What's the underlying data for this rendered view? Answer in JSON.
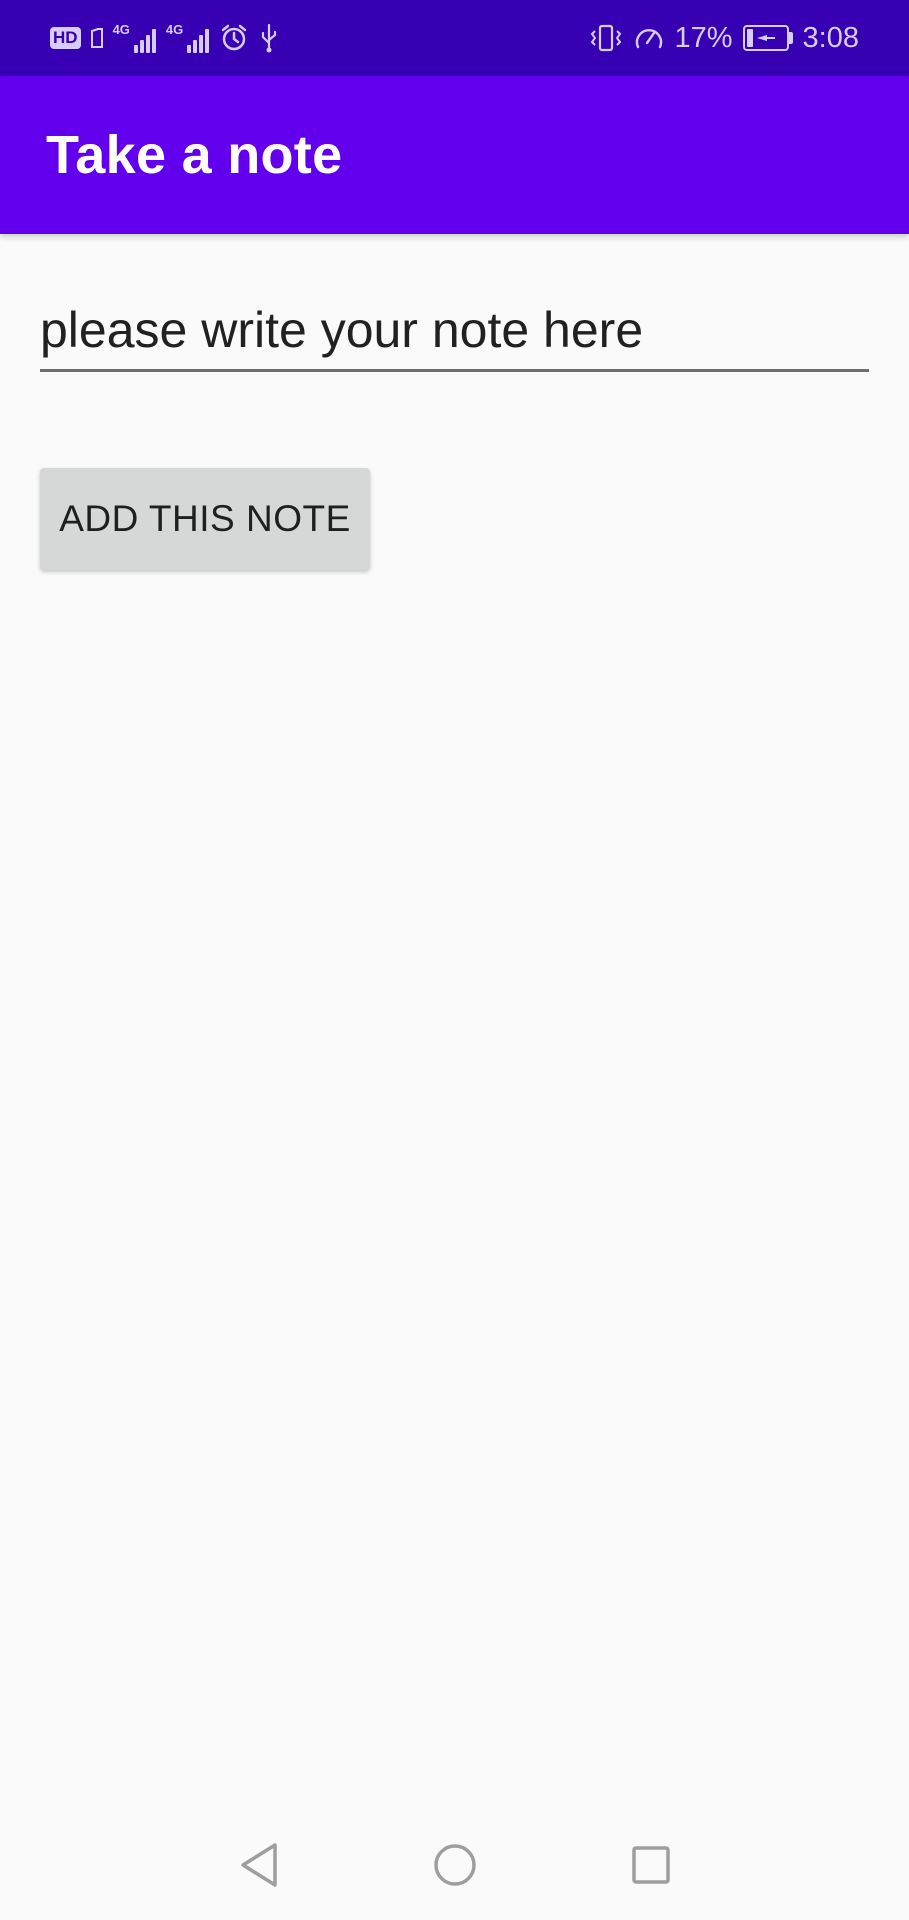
{
  "status_bar": {
    "hd_label": "HD",
    "signal_1_network": "4G",
    "signal_2_network": "4G",
    "speed_percent": "17%",
    "time": "3:08",
    "battery_level": 0.17,
    "icons": [
      "hd-icon",
      "sim-icon",
      "signal-icon",
      "signal-icon",
      "alarm-icon",
      "usb-icon",
      "vibrate-icon",
      "speedometer-icon",
      "battery-charging-icon"
    ]
  },
  "app_bar": {
    "title": "Take a note",
    "color": "#6200ee"
  },
  "note_field": {
    "placeholder": "please write your note here",
    "value": ""
  },
  "add_button": {
    "label": "ADD THIS NOTE"
  },
  "nav_bar": {
    "icons": [
      "back-icon",
      "home-icon",
      "recents-icon"
    ]
  },
  "colors": {
    "status_bar": "#3700b3",
    "primary": "#6200ee",
    "background": "#fafafa",
    "button": "#d6d7d7"
  }
}
